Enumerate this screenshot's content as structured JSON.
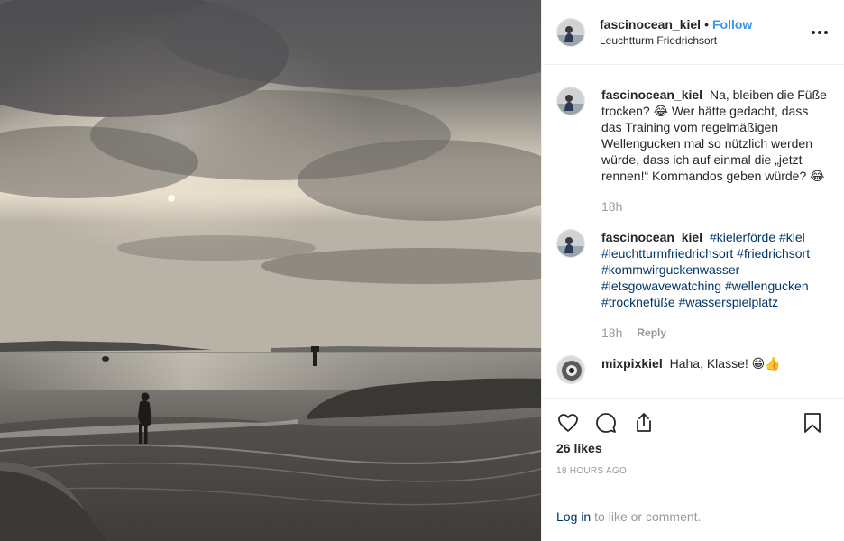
{
  "header": {
    "username": "fascinocean_kiel",
    "separator": "•",
    "follow_label": "Follow",
    "location": "Leuchtturm Friedrichsort"
  },
  "comments": [
    {
      "username": "fascinocean_kiel",
      "text": "Na, bleiben die Füße trocken? 😂 Wer hätte gedacht, dass das Training vom regelmäßigen Wellengucken mal so nützlich werden würde, dass ich auf einmal die „jetzt rennen!“ Kommandos geben würde? 😂",
      "time": "18h"
    },
    {
      "username": "fascinocean_kiel",
      "hashtags": [
        "#kielerförde",
        "#kiel",
        "#leuchtturmfriedrichsort",
        "#friedrichsort",
        "#kommwirguckenwasser",
        "#letsgowavewatching",
        "#wellengucken",
        "#trocknefüße",
        "#wasserspielplatz"
      ],
      "time": "18h",
      "reply_label": "Reply"
    },
    {
      "username": "mixpixkiel",
      "text": "Haha, Klasse! 😁👍"
    }
  ],
  "actions": {
    "likes": "26 likes",
    "posted_ago": "18 HOURS AGO",
    "icons": [
      "heart-icon",
      "comment-icon",
      "share-icon",
      "bookmark-icon"
    ]
  },
  "login": {
    "link_label": "Log in",
    "text": "to like or comment."
  },
  "colors": {
    "link_blue": "#3897f0",
    "hashtag_navy": "#003569",
    "muted_gray": "#999999",
    "text": "#262626",
    "divider": "#efefef"
  }
}
